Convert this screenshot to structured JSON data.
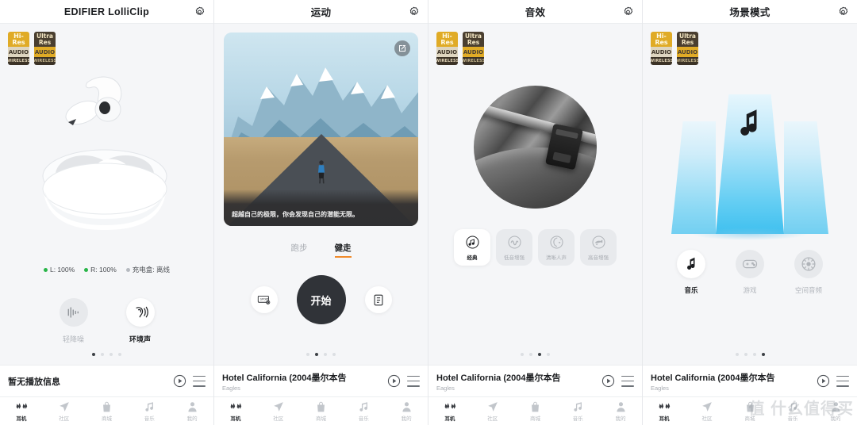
{
  "panels": [
    {
      "title": "EDIFIER LolliClip",
      "gear_icon": "gear-icon",
      "battery": [
        {
          "label": "L: 100%",
          "state": "on"
        },
        {
          "label": "R: 100%",
          "state": "on"
        },
        {
          "label": "充电盒: 离线",
          "state": "off"
        }
      ],
      "anc": [
        {
          "label": "轻降噪",
          "icon": "noise-cancel-icon",
          "active": false
        },
        {
          "label": "环境声",
          "icon": "ambient-sound-icon",
          "active": true
        }
      ],
      "pager": {
        "count": 4,
        "active": 0
      },
      "now_playing": {
        "title": "暂无播放信息",
        "artist": ""
      }
    },
    {
      "title": "运动",
      "gear_icon": "gear-icon",
      "hero": {
        "quote": "超越自己的极限，你会发现自己的潜能无限。",
        "edit_icon": "edit-icon",
        "alt": "runner-on-mountain-road"
      },
      "sport_tabs": [
        {
          "label": "跑步",
          "active": false
        },
        {
          "label": "健走",
          "active": true
        }
      ],
      "controls": {
        "left_icon": "sport-settings-icon",
        "start_label": "开始",
        "right_icon": "records-clipboard-icon"
      },
      "pager": {
        "count": 4,
        "active": 1
      },
      "now_playing": {
        "title": "Hotel California (2004墨尔本告",
        "artist": "Eagles"
      }
    },
    {
      "title": "音效",
      "gear_icon": "gear-icon",
      "artwork": "turntable-vinyl-grayscale",
      "eq_modes": [
        {
          "label": "经典",
          "icon": "music-note-circle-icon",
          "active": true
        },
        {
          "label": "低音增强",
          "icon": "sine-wave-circle-icon",
          "active": false
        },
        {
          "label": "清晰人声",
          "icon": "vocal-circle-icon",
          "active": false
        },
        {
          "label": "高音增强",
          "icon": "trumpet-circle-icon",
          "active": false
        }
      ],
      "pager": {
        "count": 4,
        "active": 2
      },
      "now_playing": {
        "title": "Hotel California (2004墨尔本告",
        "artist": "Eagles"
      }
    },
    {
      "title": "场景模式",
      "gear_icon": "gear-icon",
      "artwork": "blue-light-beams-with-music-note",
      "scenes": [
        {
          "label": "音乐",
          "icon": "music-note-icon",
          "active": true
        },
        {
          "label": "游戏",
          "icon": "gamepad-icon",
          "active": false
        },
        {
          "label": "空间音频",
          "icon": "spatial-audio-icon",
          "active": false
        }
      ],
      "pager": {
        "count": 4,
        "active": 3
      },
      "now_playing": {
        "title": "Hotel California (2004墨尔本告",
        "artist": "Eagles"
      }
    }
  ],
  "hires_badges": [
    {
      "line1": "Hi-Res",
      "line2": "AUDIO",
      "line3": "WIRELESS",
      "style": "gold"
    },
    {
      "line1": "Ultra Res",
      "line2": "AUDIO",
      "line3": "WIRELESS",
      "style": "dark"
    }
  ],
  "now_playing_controls": {
    "play_icon": "play-circle-icon",
    "playlist_icon": "playlist-icon"
  },
  "tabbar": [
    {
      "label": "耳机",
      "icon": "earbuds-icon",
      "active": true
    },
    {
      "label": "社区",
      "icon": "paper-plane-icon",
      "active": false
    },
    {
      "label": "商城",
      "icon": "shopping-bag-icon",
      "active": false
    },
    {
      "label": "音乐",
      "icon": "music-note-icon",
      "active": false
    },
    {
      "label": "我的",
      "icon": "person-icon",
      "active": false
    }
  ],
  "watermark": "值 什么值得买",
  "colors": {
    "accent": "#f08a2a",
    "battery_on": "#29b548",
    "battery_off": "#b6bac0",
    "dark": "#303338"
  }
}
